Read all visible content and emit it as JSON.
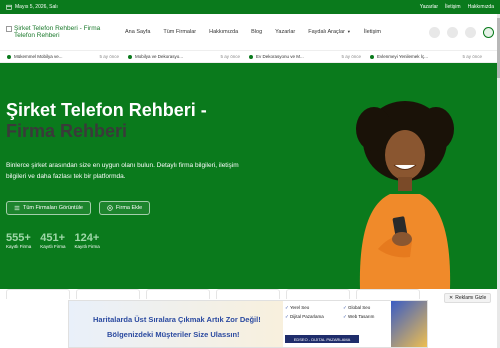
{
  "topbar": {
    "date": "Mayıs 5, 2026, Salı",
    "links": [
      "Yazarlar",
      "İletişim",
      "Hakkımızda"
    ]
  },
  "header": {
    "logo_text": "Şirket Telefon Rehberi - Firma Telefon Rehberi",
    "nav": [
      "Ana Sayfa",
      "Tüm Firmalar",
      "Hakkımızda",
      "Blog",
      "Yazarlar",
      "Faydalı Araçlar",
      "İletişim"
    ]
  },
  "ticker": [
    {
      "title": "Mükemmel Mobilya ve...",
      "ago": "5 ay önce"
    },
    {
      "title": "Mobilya ve Dekorasyo...",
      "ago": "5 ay önce"
    },
    {
      "title": "Ev Dekorasyonu ve M...",
      "ago": "5 ay önce"
    },
    {
      "title": "Evlenmeyi Yenilemek İç...",
      "ago": "5 ay önce"
    }
  ],
  "hero": {
    "title_line1": "Şirket Telefon Rehberi -",
    "title_line2": "Firma Rehberi",
    "description": "Binlerce şirket arasından size en uygun olanı bulun. Detaylı firma bilgileri, iletişim bilgileri ve daha fazlası tek bir platformda.",
    "btn_all": "Tüm Firmaları Görüntüle",
    "btn_add": "Firma Ekle",
    "stats": [
      {
        "num": "555+",
        "label": "Kayıtlı Firma"
      },
      {
        "num": "451+",
        "label": "Kayıtlı Firma"
      },
      {
        "num": "124+",
        "label": "Kayıtlı Firma"
      }
    ]
  },
  "ad": {
    "line1": "Haritalarda Üst Sıralara Çıkmak Artık Zor Değil!",
    "line2": "Bölgenizdeki Müşteriler Size Ulassın!",
    "features": [
      "Yerel Seo",
      "Global Seo",
      "Dijital Pazarlama",
      "Web Tasarım"
    ],
    "brand": "EDSEO - DIJITAL PAZARLAMA",
    "report": "Reklamı Gizle"
  },
  "colors": {
    "brand_green": "#0a7a1c",
    "accent_dark": "#3a3a3a",
    "stat_green": "#9fd8a8"
  }
}
